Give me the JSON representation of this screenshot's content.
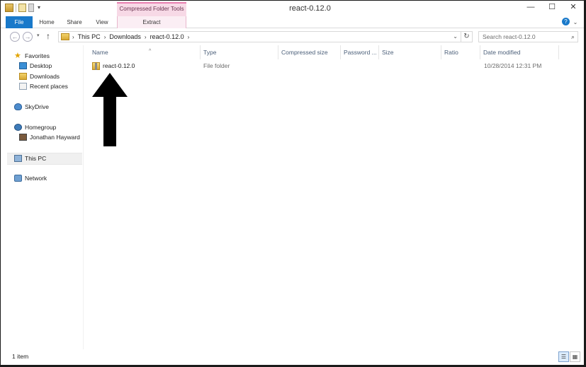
{
  "window": {
    "title": "react-0.12.0",
    "minimize_glyph": "—",
    "maximize_glyph": "☐",
    "close_glyph": "✕"
  },
  "quick_access": {
    "dropdown_glyph": "▾"
  },
  "ribbon": {
    "context_group": "Compressed Folder Tools",
    "tabs": {
      "file": "File",
      "home": "Home",
      "share": "Share",
      "view": "View",
      "extract": "Extract"
    },
    "expand_glyph": "⌄",
    "help_glyph": "?"
  },
  "navigation": {
    "back_glyph": "←",
    "forward_glyph": "→",
    "history_glyph": "▾",
    "up_glyph": "↑",
    "refresh_glyph": "↻"
  },
  "address_bar": {
    "crumbs": [
      "This PC",
      "Downloads",
      "react-0.12.0"
    ],
    "separator": "›",
    "dropdown_glyph": "⌄"
  },
  "search": {
    "placeholder": "Search react-0.12.0",
    "icon_glyph": "⌕"
  },
  "nav_pane": {
    "favorites": "Favorites",
    "desktop": "Desktop",
    "downloads": "Downloads",
    "recent_places": "Recent places",
    "skydrive": "SkyDrive",
    "homegroup": "Homegroup",
    "homegroup_user": "Jonathan Hayward",
    "this_pc": "This PC",
    "network": "Network",
    "star_glyph": "★"
  },
  "columns": {
    "name": "Name",
    "type": "Type",
    "compressed_size": "Compressed size",
    "password": "Password ...",
    "size": "Size",
    "ratio": "Ratio",
    "date_modified": "Date modified",
    "sort_glyph": "^"
  },
  "files": [
    {
      "name": "react-0.12.0",
      "type": "File folder",
      "date_modified": "10/28/2014 12:31 PM"
    }
  ],
  "status_bar": {
    "item_count": "1 item",
    "details_view_glyph": "☰",
    "tiles_view_glyph": "▦"
  },
  "annotation": {
    "arrow_color": "#000000"
  },
  "colors": {
    "file_tab": "#1979ca",
    "context_tab": "#f7d9e6",
    "header_text": "#4c607a",
    "secondary_text": "#6d6d6d"
  }
}
